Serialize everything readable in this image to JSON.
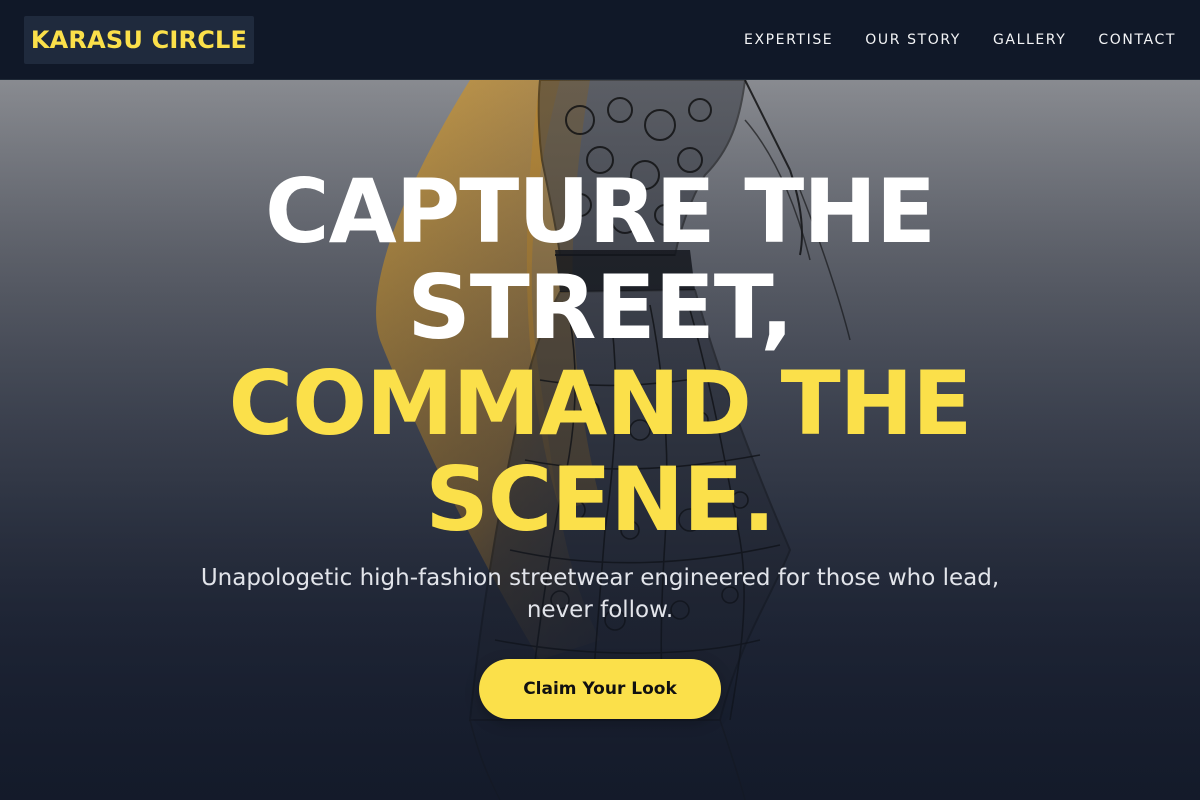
{
  "header": {
    "logo_text": "KARASU CIRCLE",
    "nav": [
      {
        "label": "EXPERTISE"
      },
      {
        "label": "OUR STORY"
      },
      {
        "label": "GALLERY"
      },
      {
        "label": "CONTACT"
      }
    ]
  },
  "hero": {
    "headline_line1": "CAPTURE THE",
    "headline_line2": "STREET,",
    "headline_line3": "COMMAND THE",
    "headline_line4": "SCENE.",
    "subtitle": "Unapologetic high-fashion streetwear engineered for those who lead, never follow.",
    "cta_label": "Claim Your Look",
    "background_art": "fashion-sketch-illustration"
  },
  "colors": {
    "accent": "#fbe04a",
    "header_bg": "#101828",
    "logo_bg": "#1f2a3d"
  }
}
